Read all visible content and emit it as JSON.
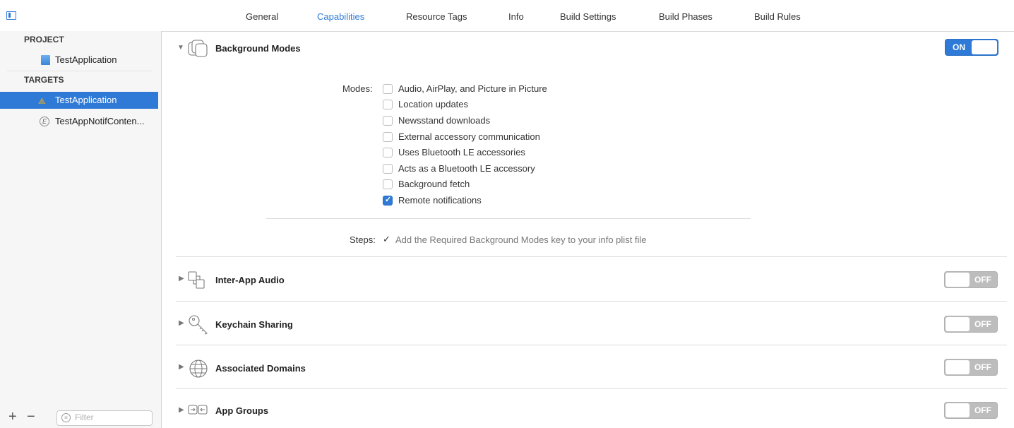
{
  "tabs": [
    {
      "label": "General"
    },
    {
      "label": "Capabilities"
    },
    {
      "label": "Resource Tags"
    },
    {
      "label": "Info"
    },
    {
      "label": "Build Settings"
    },
    {
      "label": "Build Phases"
    },
    {
      "label": "Build Rules"
    }
  ],
  "active_tab": "Capabilities",
  "sidebar": {
    "project_header": "PROJECT",
    "project_item": "TestApplication",
    "targets_header": "TARGETS",
    "targets": [
      {
        "label": "TestApplication",
        "selected": true
      },
      {
        "label": "TestAppNotifConten..."
      }
    ],
    "filter_placeholder": "Filter",
    "add_glyph": "+",
    "remove_glyph": "−"
  },
  "capabilities": {
    "background_modes": {
      "title": "Background Modes",
      "toggle": "ON",
      "modes_label": "Modes:",
      "modes": [
        {
          "label": "Audio, AirPlay, and Picture in Picture",
          "checked": false
        },
        {
          "label": "Location updates",
          "checked": false
        },
        {
          "label": "Newsstand downloads",
          "checked": false
        },
        {
          "label": "External accessory communication",
          "checked": false
        },
        {
          "label": "Uses Bluetooth LE accessories",
          "checked": false
        },
        {
          "label": "Acts as a Bluetooth LE accessory",
          "checked": false
        },
        {
          "label": "Background fetch",
          "checked": false
        },
        {
          "label": "Remote notifications",
          "checked": true
        }
      ],
      "steps_label": "Steps:",
      "steps_check": "✓",
      "steps_text": "Add the Required Background Modes key to your info plist file"
    },
    "inter_app_audio": {
      "title": "Inter-App Audio",
      "toggle": "OFF"
    },
    "keychain_sharing": {
      "title": "Keychain Sharing",
      "toggle": "OFF"
    },
    "associated_domains": {
      "title": "Associated Domains",
      "toggle": "OFF"
    },
    "app_groups": {
      "title": "App Groups",
      "toggle": "OFF"
    }
  },
  "colors": {
    "accent": "#2f7ad6",
    "toggle_off": "#bdbdbd"
  }
}
